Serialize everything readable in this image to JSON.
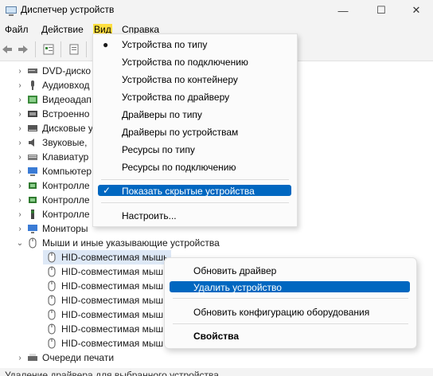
{
  "window": {
    "title": "Диспетчер устройств",
    "minimize": "—",
    "maximize": "☐",
    "close": "✕"
  },
  "menubar": [
    "Файл",
    "Действие",
    "Вид",
    "Справка"
  ],
  "tree": {
    "items": [
      {
        "label": "DVD-диско",
        "icon": "dvd-drive-icon",
        "expanded": false
      },
      {
        "label": "Аудиовход",
        "icon": "audio-icon",
        "expanded": false
      },
      {
        "label": "Видеоадап",
        "icon": "display-adapter-icon",
        "expanded": false
      },
      {
        "label": "Встроенно",
        "icon": "firmware-icon",
        "expanded": false
      },
      {
        "label": "Дисковые у",
        "icon": "disk-drive-icon",
        "expanded": false
      },
      {
        "label": "Звуковые,",
        "icon": "sound-icon",
        "expanded": false
      },
      {
        "label": "Клавиатур",
        "icon": "keyboard-icon",
        "expanded": false
      },
      {
        "label": "Компьютер",
        "icon": "computer-icon",
        "expanded": false
      },
      {
        "label": "Контролле",
        "icon": "controller-icon",
        "expanded": false
      },
      {
        "label": "Контролле",
        "icon": "controller-icon",
        "expanded": false
      },
      {
        "label": "Контролле",
        "icon": "usb-controller-icon",
        "expanded": false
      },
      {
        "label": "Мониторы",
        "icon": "monitor-icon",
        "expanded": false
      },
      {
        "label": "Мыши и иные указывающие устройства",
        "icon": "mouse-icon",
        "expanded": true
      }
    ],
    "children": [
      "HID-совместимая мышь",
      "HID-совместимая мыш",
      "HID-совместимая мыш",
      "HID-совместимая мыш",
      "HID-совместимая мыш",
      "HID-совместимая мыш",
      "HID-совместимая мыш"
    ],
    "after": "Очереди печати"
  },
  "view_menu": {
    "items": [
      "Устройства по типу",
      "Устройства по подключению",
      "Устройства по контейнеру",
      "Устройства по драйверу",
      "Драйверы по типу",
      "Драйверы по устройствам",
      "Ресурсы по типу",
      "Ресурсы по подключению"
    ],
    "show_hidden": "Показать скрытые устройства",
    "customize": "Настроить..."
  },
  "context_menu": {
    "update_driver": "Обновить драйвер",
    "uninstall": "Удалить устройство",
    "scan_hardware": "Обновить конфигурацию оборудования",
    "properties": "Свойства"
  },
  "status_bar": "Удаление драйвера для выбранного устройства.",
  "colors": {
    "highlight": "#0067c0",
    "menu_accent": "#ffdf3f"
  }
}
